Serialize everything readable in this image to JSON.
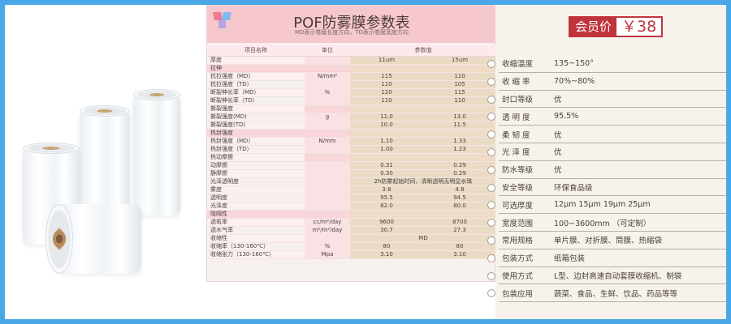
{
  "table": {
    "title": "POF防雾膜参数表",
    "subtitle": "MD表示卷膜长度方向，TD表示卷膜宽度方向",
    "headers": [
      "项目名称",
      "单位",
      "参数值",
      ""
    ],
    "rows": [
      [
        "厚度",
        "",
        "11um",
        "15um"
      ],
      [
        "拉伸",
        "",
        "",
        ""
      ],
      [
        "抗拉强度（MD）",
        "N/mm²",
        "115",
        "110"
      ],
      [
        "抗拉强度（TD）",
        "",
        "110",
        "105"
      ],
      [
        "断裂伸长率（MD）",
        "%",
        "120",
        "115"
      ],
      [
        "断裂伸长率（TD）",
        "",
        "110",
        "110"
      ],
      [
        "撕裂强度",
        "",
        "",
        ""
      ],
      [
        "撕裂强度(MD)",
        "g",
        "11.0",
        "13.0"
      ],
      [
        "撕裂强度(TD)",
        "",
        "10.0",
        "11.5"
      ],
      [
        "热封强度",
        "",
        "",
        ""
      ],
      [
        "热封强度（MD）",
        "N/mm",
        "1.10",
        "1.33"
      ],
      [
        "热封强度（TD）",
        "",
        "1.00",
        "1.23"
      ],
      [
        "热动摩擦",
        "",
        "",
        ""
      ],
      [
        "动摩擦",
        "",
        "0.31",
        "0.29"
      ],
      [
        "静摩擦",
        "",
        "0.30",
        "0.29"
      ],
      [
        "光泽透明度",
        "",
        "2h防雾起始时间，清晰透明无明显水珠",
        ""
      ],
      [
        "雾度",
        "",
        "3.8",
        "4.8"
      ],
      [
        "透明度",
        "",
        "95.5",
        "94.5"
      ],
      [
        "光泽度",
        "",
        "82.0",
        "80.0"
      ],
      [
        "阻隔性",
        "",
        "",
        ""
      ],
      [
        "透氧率",
        "cc/m²/day",
        "9600",
        "8700"
      ],
      [
        "透水气率",
        "m²/m²/day",
        "30.7",
        "27.3"
      ],
      [
        "收缩性",
        "",
        "MD",
        ""
      ],
      [
        "收缩率（130-160℃）",
        "%",
        "80",
        "80"
      ],
      [
        "收缩张力（130-160℃）",
        "Mpa",
        "3.10",
        "3.10"
      ]
    ]
  },
  "price": {
    "label": "会员价",
    "value": "￥38"
  },
  "specs": [
    {
      "label": "收缩温度",
      "value": "135~150°"
    },
    {
      "label": "收 缩 率",
      "value": "70%~80%"
    },
    {
      "label": "封口等级",
      "value": "优"
    },
    {
      "label": "透 明 度",
      "value": "95.5%"
    },
    {
      "label": "柔 韧 度",
      "value": "优"
    },
    {
      "label": "光 泽 度",
      "value": "优"
    },
    {
      "label": "防水等级",
      "value": "优"
    },
    {
      "label": "安全等级",
      "value": "环保食品级"
    },
    {
      "label": "可选厚度",
      "value": "12μm  15μm  19μm  25μm"
    },
    {
      "label": "宽度范围",
      "value": "100~3600mm （可定制）"
    },
    {
      "label": "常用规格",
      "value": "单片膜、对折膜、筒膜、热缩袋"
    },
    {
      "label": "包装方式",
      "value": "纸箱包装"
    },
    {
      "label": "使用方式",
      "value": "L型、边封高速自动套膜收缩机、制袋"
    },
    {
      "label": "包装应用",
      "value": "蔬菜、食品、生鲜、饮品、药品等等"
    }
  ],
  "colors": {
    "frame": "#4aa8e8",
    "price": "#c0343c",
    "title_bar": "#f6c8cd"
  }
}
